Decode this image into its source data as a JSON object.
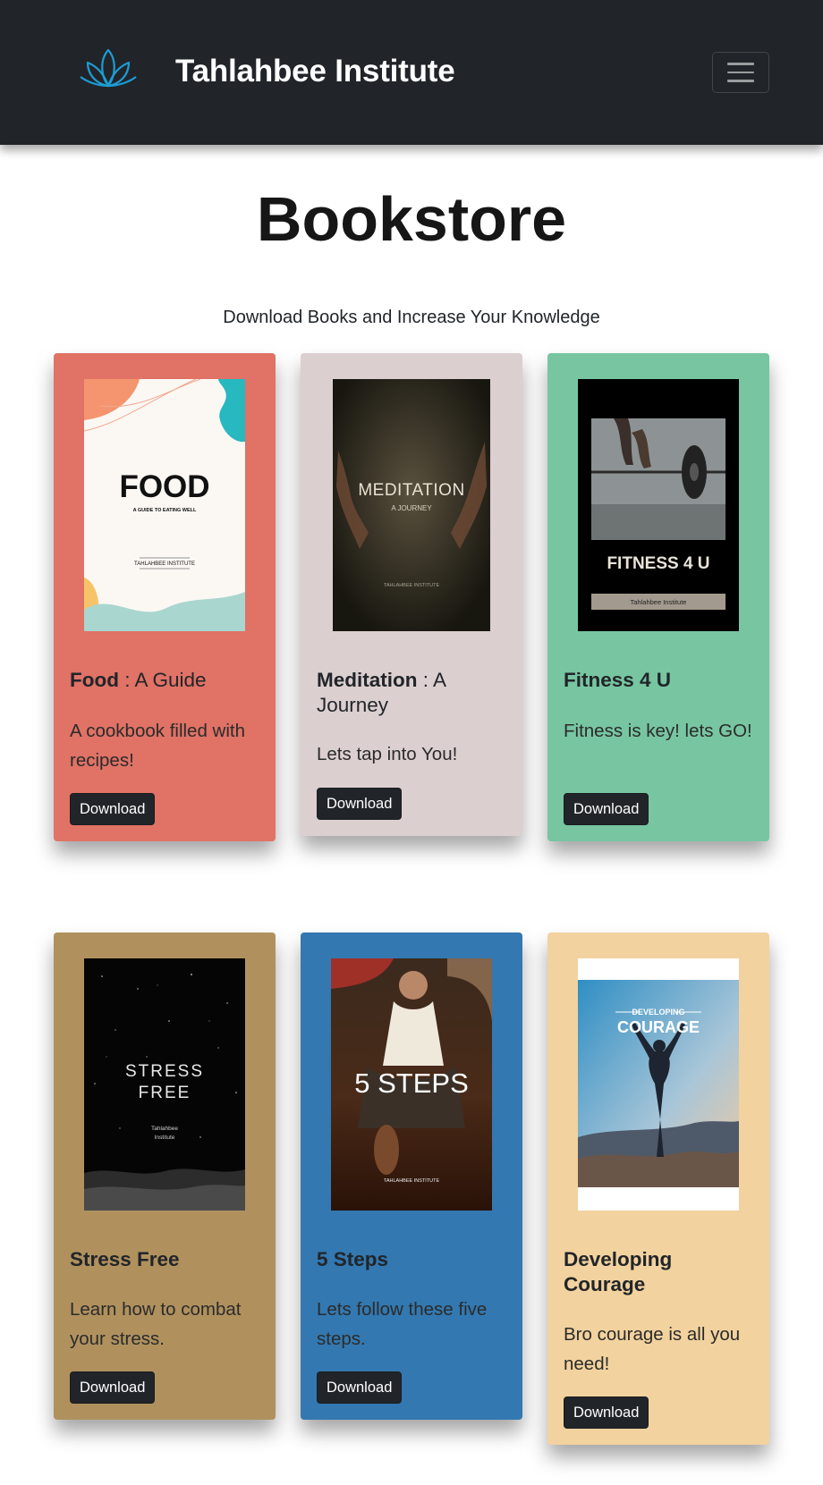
{
  "navbar": {
    "brand": "Tahlahbee Institute",
    "logo_icon": "lotus-icon",
    "menu_icon": "hamburger-icon"
  },
  "page": {
    "title": "Bookstore",
    "subtitle": "Download Books and Increase Your Knowledge"
  },
  "download_label": "Download",
  "books": [
    {
      "title_bold": "Food",
      "title_rest": " : A Guide",
      "description": "A cookbook filled with recipes!",
      "card_color": "#e07266",
      "cover": {
        "heading": "FOOD",
        "tagline": "A GUIDE TO EATING WELL",
        "publisher": "TAHLAHBEE INSTITUTE"
      }
    },
    {
      "title_bold": "Meditation",
      "title_rest": " : A Journey",
      "description": "Lets tap into You!",
      "card_color": "#dccfd0",
      "cover": {
        "heading": "MEDITATION",
        "tagline": "A JOURNEY",
        "publisher": "TAHLAHBEE INSTITUTE"
      }
    },
    {
      "title_bold": "Fitness 4 U",
      "title_rest": "",
      "description": "Fitness is key! lets GO!",
      "card_color": "#77c6a1",
      "cover": {
        "heading": "FITNESS 4 U",
        "publisher": "Tahlahbee Institute"
      }
    },
    {
      "title_bold": "Stress Free",
      "title_rest": "",
      "description": "Learn how to combat your stress.",
      "card_color": "#b0915e",
      "cover": {
        "heading_line1": "STRESS",
        "heading_line2": "FREE",
        "publisher_line1": "Tahlahbee",
        "publisher_line2": "Institute"
      }
    },
    {
      "title_bold": "5 Steps",
      "title_rest": "",
      "description": "Lets follow these five steps.",
      "card_color": "#3378b0",
      "cover": {
        "heading": "5 STEPS",
        "publisher": "TAHLAHBEE INSTITUTE"
      }
    },
    {
      "title_bold": "Developing Courage",
      "title_rest": "",
      "description": "Bro courage is all you need!",
      "card_color": "#f2d29e",
      "cover": {
        "heading_line1": "DEVELOPING",
        "heading_line2": "COURAGE"
      }
    }
  ]
}
